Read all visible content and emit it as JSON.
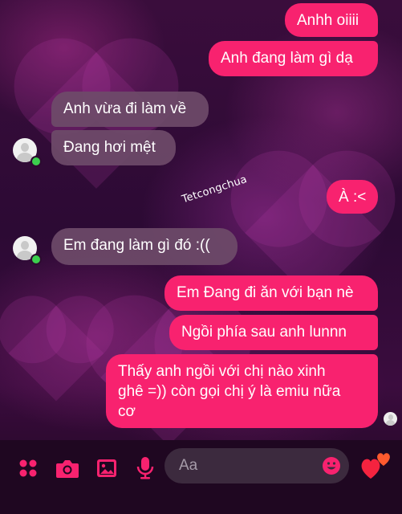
{
  "watermark": "Tetcongchua",
  "messages": [
    {
      "text": "Anhh oiiii",
      "sender": "me"
    },
    {
      "text": "Anh đang làm gì dạ",
      "sender": "me"
    },
    {
      "text": "Anh vừa đi làm về",
      "sender": "contact"
    },
    {
      "text": "Đang hơi mệt",
      "sender": "contact"
    },
    {
      "text": "À :<",
      "sender": "me"
    },
    {
      "text": "Em đang làm gì đó :((",
      "sender": "contact"
    },
    {
      "text": "Em Đang đi ăn với bạn nè",
      "sender": "me"
    },
    {
      "text": "Ngồi  phía sau anh lunnn",
      "sender": "me"
    },
    {
      "text_lines": [
        "Thấy anh ngồi với chị nào xinh",
        "ghê =)) còn gọi chị ý là emiu nữa",
        "cơ"
      ],
      "sender": "me"
    }
  ],
  "composer": {
    "placeholder": "Aa",
    "icons": [
      "apps-icon",
      "camera-icon",
      "gallery-icon",
      "microphone-icon",
      "emoji-icon",
      "hearts-icon"
    ]
  },
  "colors": {
    "outgoing_bubble": "#f8226f",
    "incoming_bubble": "#6e4b69",
    "accent": "#f8226f",
    "online": "#3ccf4e"
  }
}
